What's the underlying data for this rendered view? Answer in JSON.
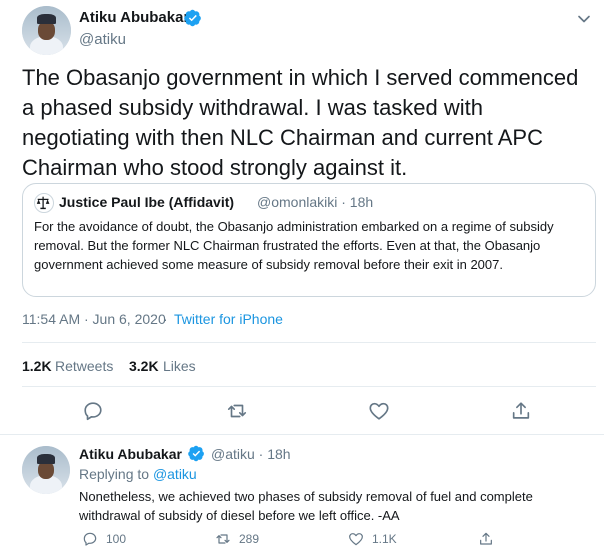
{
  "main_tweet": {
    "author_name": "Atiku Abubakar",
    "handle": "@atiku",
    "text": "The Obasanjo government in which I served commenced a phased subsidy withdrawal. I was tasked with negotiating with then NLC Chairman and current APC Chairman who stood strongly against it.",
    "timestamp": "11:54 AM · Jun 6, 2020",
    "separator": "·",
    "source": "Twitter for iPhone",
    "retweets_count": "1.2K",
    "retweets_label": "Retweets",
    "likes_count": "3.2K",
    "likes_label": "Likes",
    "icons": {
      "more": "chevron-down-icon",
      "reply": "reply-icon",
      "retweet": "retweet-icon",
      "like": "heart-icon",
      "share": "share-icon",
      "verified": "verified-badge-icon"
    }
  },
  "quoted_tweet": {
    "author_name": "Justice Paul Ibe (Affidavit)",
    "handle_time": "@omonlakiki · 18h",
    "text": "For the avoidance of doubt, the Obasanjo administration embarked on a regime of subsidy removal. But the former NLC Chairman frustrated the efforts. Even at that, the Obasanjo government achieved some measure of subsidy removal before their exit in 2007.",
    "icons": {
      "avatar": "scales-of-justice-icon"
    }
  },
  "reply_tweet": {
    "author_name": "Atiku Abubakar",
    "handle_time": "@atiku · 18h",
    "replying_prefix": "Replying to ",
    "replying_to": "@atiku",
    "text": "Nonetheless, we achieved two phases of subsidy removal of fuel and complete withdrawal of subsidy of diesel before we left office. -AA",
    "reply_count": "100",
    "retweet_count": "289",
    "like_count": "1.1K"
  },
  "colors": {
    "text": "#14171a",
    "secondary": "#657786",
    "link": "#1b95e0",
    "divider": "#e6ecf0",
    "border": "#ccd6dd"
  }
}
